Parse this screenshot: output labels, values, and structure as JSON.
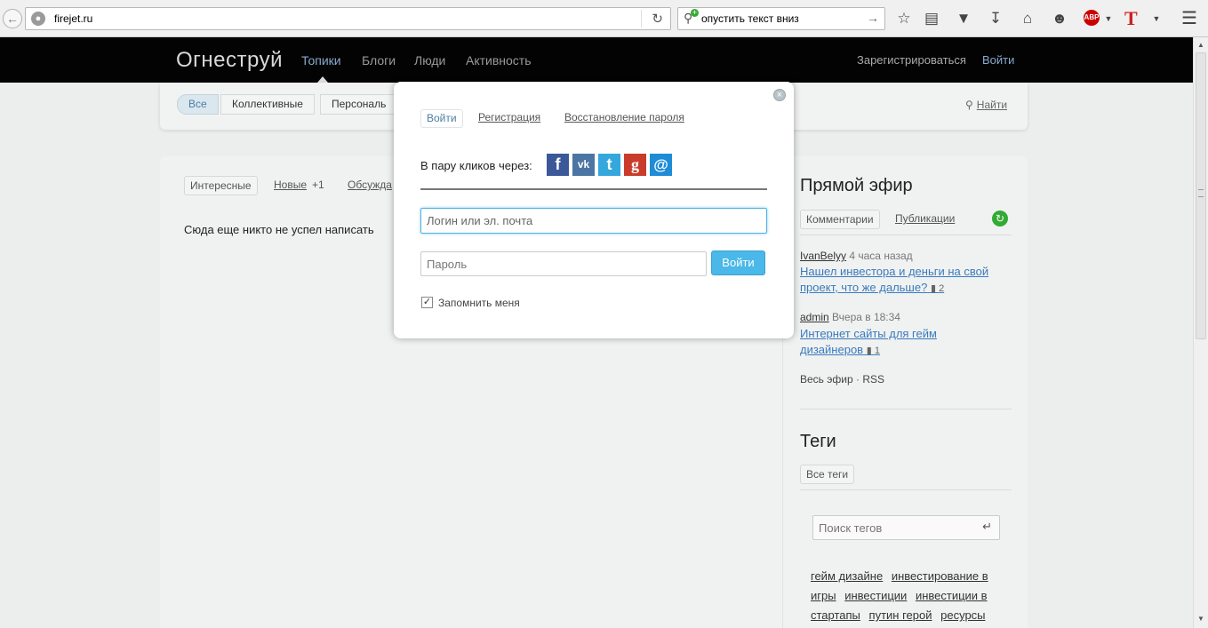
{
  "browser": {
    "url": "firejet.ru",
    "search_text": "опустить текст вниз",
    "back_icon": "arrow-left-icon",
    "reload_icon": "reload-icon"
  },
  "site": {
    "logo": "Огнеструй",
    "nav": [
      "Топики",
      "Блоги",
      "Люди",
      "Активность"
    ],
    "register": "Зарегистрироваться",
    "login": "Войти"
  },
  "filters": {
    "all": "Все",
    "collective": "Коллективные",
    "personal": "Персональ",
    "find": "Найти"
  },
  "main": {
    "tabs": {
      "interesting": "Интересные",
      "new": "Новые",
      "new_count": "+1",
      "discussed": "Обсужда"
    },
    "empty_text": "Сюда еще никто не успел написать"
  },
  "sidebar": {
    "live_title": "Прямой эфир",
    "tab_comments": "Комментарии",
    "tab_publications": "Публикации",
    "feed": [
      {
        "author": "IvanBelyy",
        "time": "4 часа назад",
        "title": "Нашел инвестора и деньги на свой проект, что же дальше?",
        "comments": "2"
      },
      {
        "author": "admin",
        "time": "Вчера в 18:34",
        "title": "Интернет сайты для гейм дизайнеров",
        "comments": "1"
      }
    ],
    "all_feed": "Весь эфир",
    "dot": "·",
    "rss": "RSS",
    "tags_title": "Теги",
    "all_tags": "Все теги",
    "tag_search_placeholder": "Поиск тегов",
    "tags": [
      "гейм дизайне",
      "инвестирование в игры",
      "инвестиции",
      "инвестиции в стартапы",
      "путин герой",
      "ресурсы"
    ]
  },
  "modal": {
    "tab_login": "Войти",
    "tab_register": "Регистрация",
    "tab_restore": "Восстановление пароля",
    "social_label": "В пару кликов через:",
    "social": {
      "fb": "f",
      "vk": "vk",
      "tw": "t",
      "gp": "g",
      "mail": "@"
    },
    "login_placeholder": "Логин или эл. почта",
    "password_placeholder": "Пароль",
    "submit": "Войти",
    "remember": "Запомнить меня",
    "remember_checked": true,
    "close": "×"
  },
  "colors": {
    "header_bg": "#030303",
    "accent": "#4ab8e8",
    "link": "#3a7abf",
    "overlay": "#eceeed"
  }
}
